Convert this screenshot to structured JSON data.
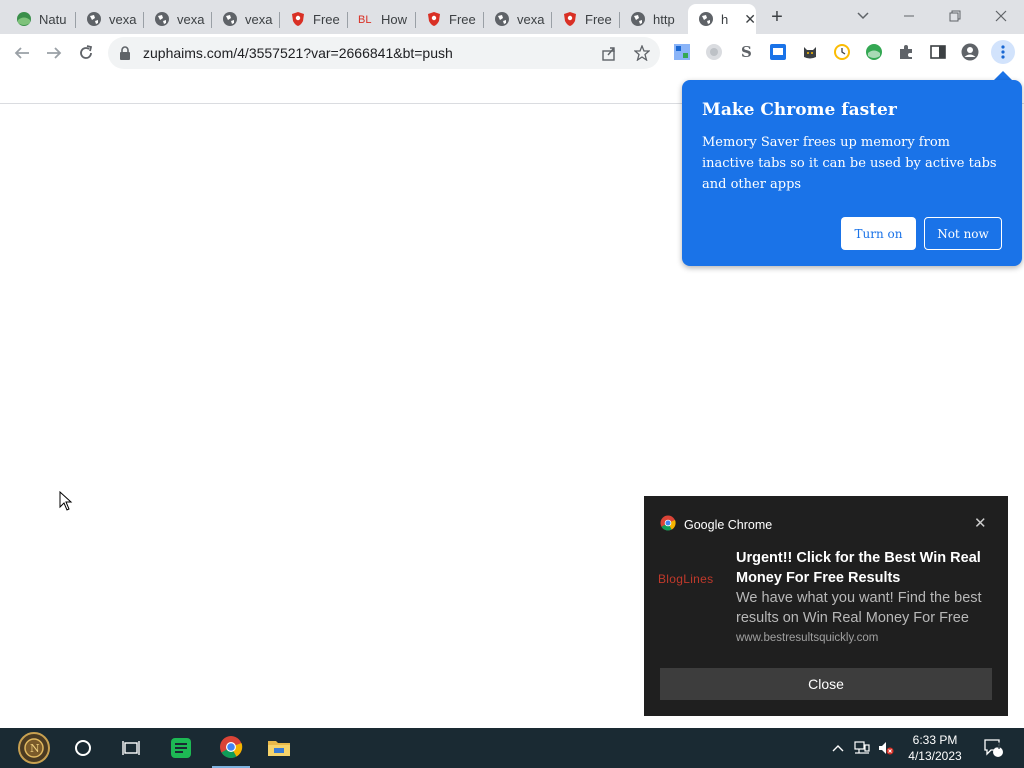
{
  "tabs": [
    {
      "title": "Natu",
      "icon": "globe-leaf-icon",
      "active": false
    },
    {
      "title": "vexa",
      "icon": "globe-icon",
      "active": false
    },
    {
      "title": "vexa",
      "icon": "globe-icon",
      "active": false
    },
    {
      "title": "vexa",
      "icon": "globe-icon",
      "active": false
    },
    {
      "title": "Free",
      "icon": "red-shield-icon",
      "active": false
    },
    {
      "title": "How",
      "icon": "bl-icon",
      "active": false
    },
    {
      "title": "Free",
      "icon": "red-shield-icon",
      "active": false
    },
    {
      "title": "vexa",
      "icon": "globe-icon",
      "active": false
    },
    {
      "title": "Free",
      "icon": "red-shield-icon",
      "active": false
    },
    {
      "title": "http",
      "icon": "globe-icon",
      "active": false
    },
    {
      "title": "h",
      "icon": "globe-icon",
      "active": true
    }
  ],
  "toolbar": {
    "url": "zuphaims.com/4/3557521?var=2666841&bt=push"
  },
  "memory_saver": {
    "title": "Make Chrome faster",
    "body": "Memory Saver frees up memory from inactive tabs so it can be used by active tabs and other apps",
    "turn_on": "Turn on",
    "not_now": "Not now",
    "color": "#1a73e8"
  },
  "notification": {
    "app_name": "Google Chrome",
    "logo_text": "BlogLines",
    "title": "Urgent!! Click for the Best Win Real Money For Free Results",
    "body": "We have what you want! Find the best results on Win Real Money For Free",
    "site": "www.bestresultsquickly.com",
    "close_button": "Close"
  },
  "taskbar": {
    "time": "6:33 PM",
    "date": "4/13/2023",
    "notification_count": "4"
  }
}
